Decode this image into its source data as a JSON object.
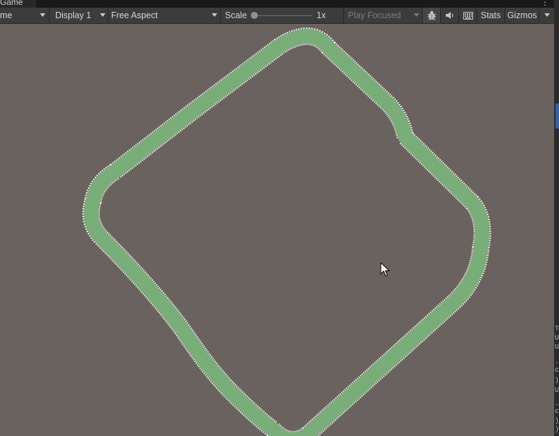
{
  "window": {
    "tab_label": "Game",
    "menu_glyph": "⋮"
  },
  "toolbar": {
    "view_dropdown_fragment": "me",
    "display_label": "Display 1",
    "aspect_label": "Free Aspect",
    "scale_label": "Scale",
    "scale_value": "1x",
    "scale_fraction": 0.0,
    "play_mode_label": "Play Focused",
    "stats_label": "Stats",
    "gizmos_label": "Gizmos"
  },
  "console_fragments": [
    "T",
    "U",
    "U",
    ".",
    "c",
    ")",
    "U",
    ".",
    "c",
    ")",
    ")"
  ],
  "colors": {
    "viewport_bg": "#6a625e",
    "track_green": "#7aae78",
    "toolbar_bg": "#3c3c3c",
    "accent_blue": "#2e64a4"
  },
  "icons": [
    "bug-icon",
    "speaker-icon",
    "keyboard-icon",
    "cursor-arrow-icon"
  ]
}
